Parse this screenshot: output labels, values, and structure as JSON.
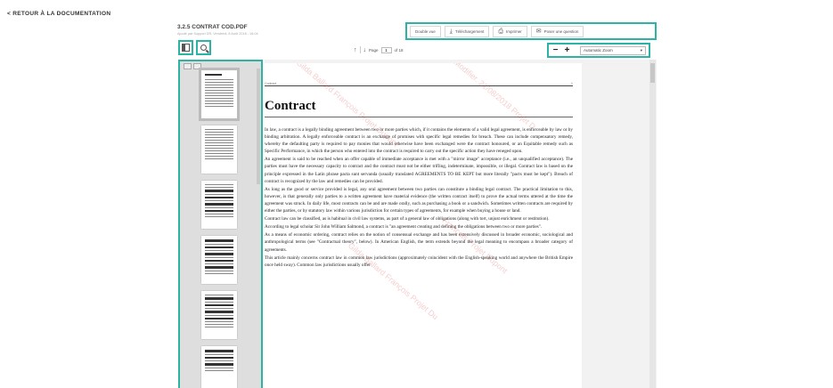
{
  "back_link": "< RETOUR À LA DOCUMENTATION",
  "document": {
    "title": "3.2.5 CONTRAT COD.PDF",
    "meta": "Ajouté par Support DR, Vendredi, 8 Août 2018 - 16:04"
  },
  "toolbar": {
    "double_view": "Double vue",
    "download": "Téléchargement",
    "print": "Imprimer",
    "ask": "Poser une question"
  },
  "pager": {
    "label": "Page",
    "current": "1",
    "of": "of 18"
  },
  "zoom": {
    "minus": "−",
    "plus": "+",
    "selected": "Automatic Zoom",
    "caret": "▾"
  },
  "page": {
    "running_head": "Contract",
    "running_page": "1",
    "heading": "Contract",
    "paragraphs": [
      "In law, a contract is a legally binding agreement between two or more parties which, if it contains the elements of a valid legal agreement, is enforceable by law or by binding arbitration. A legally enforceable contract is an exchange of promises with specific legal remedies for breach. These can include compensatory remedy, whereby the defaulting party is required to pay monies that would otherwise have been exchanged were the contract honoured, or an Equitable remedy such as Specific Performance, in which the person who entered into the contract is required to carry out the specific action they have reneged upon.",
      "An agreement is said to be reached when an offer capable of immediate acceptance is met with a \"mirror image\" acceptance (i.e., an unqualified acceptance). The parties must have the necessary capacity to contract and the contract must not be either trifling, indeterminate, impossible, or illegal. Contract law is based on the principle expressed in the Latin phrase pacta sunt servanda (usually translated AGREEMENTS TO BE KEPT but more literally \"pacts must be kept\"). Breach of contract is recognized by the law and remedies can be provided.",
      "As long as the good or service provided is legal, any oral agreement between two parties can constitute a binding legal contract. The practical limitation to this, however, is that generally only parties to a written agreement have material evidence (the written contract itself) to prove the actual terms uttered at the time the agreement was struck. In daily life, most contracts can be and are made orally, such as purchasing a book or a sandwich. Sometimes written contracts are required by either the parties, or by statutory law within various jurisdiction for certain types of agreements, for example when buying a house or land.",
      "Contract law can be classified, as is habitual in civil law systems, as part of a general law of obligations (along with tort, unjust enrichment or restitution).",
      "According to legal scholar Sir John William Salmond, a contract is \"an agreement creating and defining the obligations between two or more parties\".",
      "As a means of economic ordering, contract relies on the notion of consensual exchange and has been extensively discussed in broader economic, sociological and anthropological terms (see \"Contractual theory\", below). In American English, the term extends beyond the legal meaning to encompass a broader category of agreements.",
      "This article mainly concerns contract law in common law jurisdictions (approximately coincident with the English-speaking world and anywhere the British Empire once held sway). Common law jurisdictions usually offer"
    ],
    "watermarks": [
      "Gilda Ballard François Projet Dupont",
      "Modifier. 21/08/2018 Projet D",
      "François Projet Dupont",
      "Gilda Ballard François Projet Du"
    ]
  },
  "colors": {
    "highlight": "#2bb3a6",
    "watermark": "#dc5050"
  }
}
